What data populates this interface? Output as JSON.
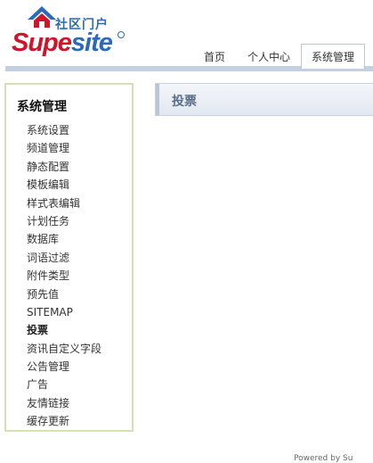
{
  "logo": {
    "subtitle": "社区门户",
    "wordmark": "Supesite",
    "icon": "house-icon"
  },
  "nav": {
    "tabs": [
      {
        "label": "首页"
      },
      {
        "label": "个人中心"
      },
      {
        "label": "系统管理",
        "active": true
      }
    ]
  },
  "sidebar": {
    "title": "系统管理",
    "items": [
      {
        "label": "系统设置"
      },
      {
        "label": "频道管理"
      },
      {
        "label": "静态配置"
      },
      {
        "label": "模板编辑"
      },
      {
        "label": "样式表编辑"
      },
      {
        "label": "计划任务"
      },
      {
        "label": "数据库"
      },
      {
        "label": "词语过滤"
      },
      {
        "label": "附件类型"
      },
      {
        "label": "预先值"
      },
      {
        "label": "SITEMAP"
      },
      {
        "label": "投票",
        "current": true
      },
      {
        "label": "资讯自定义字段"
      },
      {
        "label": "公告管理"
      },
      {
        "label": "广告"
      },
      {
        "label": "友情链接"
      },
      {
        "label": "缓存更新"
      }
    ]
  },
  "content": {
    "title": "投票"
  },
  "footer": {
    "text": "Powered by Su"
  },
  "colors": {
    "brand_red": "#d0142a",
    "brand_blue": "#2a6bb8",
    "sidebar_border": "#d6e0b6",
    "header_bar": "#c3d0e2"
  }
}
